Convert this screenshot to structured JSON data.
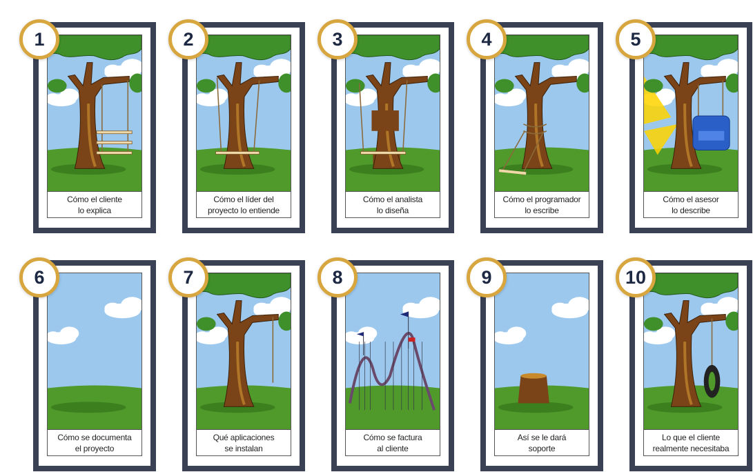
{
  "colors": {
    "frame": "#3a4154",
    "badge_border": "#d8a63e",
    "badge_text": "#1d2943",
    "sky": "#9cc8ee",
    "grass": "#4f9a2a",
    "trunk": "#7a4418",
    "leaves": "#3f8f2a"
  },
  "panels": [
    {
      "number": "1",
      "caption": "Cómo el cliente\nlo explica",
      "scene": "swing-three-boards"
    },
    {
      "number": "2",
      "caption": "Cómo el líder del\nproyecto lo entiende",
      "scene": "swing-around-trunk"
    },
    {
      "number": "3",
      "caption": "Cómo el analista\nlo diseña",
      "scene": "cut-trunk-swing"
    },
    {
      "number": "4",
      "caption": "Cómo el programador\nlo escribe",
      "scene": "rope-tied-trunk"
    },
    {
      "number": "5",
      "caption": "Cómo el asesor\nlo describe",
      "scene": "armchair-swing"
    },
    {
      "number": "6",
      "caption": "Cómo se documenta\nel proyecto",
      "scene": "empty-field"
    },
    {
      "number": "7",
      "caption": "Qué aplicaciones\nse instalan",
      "scene": "single-rope"
    },
    {
      "number": "8",
      "caption": "Cómo se factura\nal cliente",
      "scene": "roller-coaster"
    },
    {
      "number": "9",
      "caption": "Así se le dará\nsoporte",
      "scene": "stump"
    },
    {
      "number": "10",
      "caption": "Lo que el cliente\nrealmente necesitaba",
      "scene": "tire-swing"
    }
  ]
}
